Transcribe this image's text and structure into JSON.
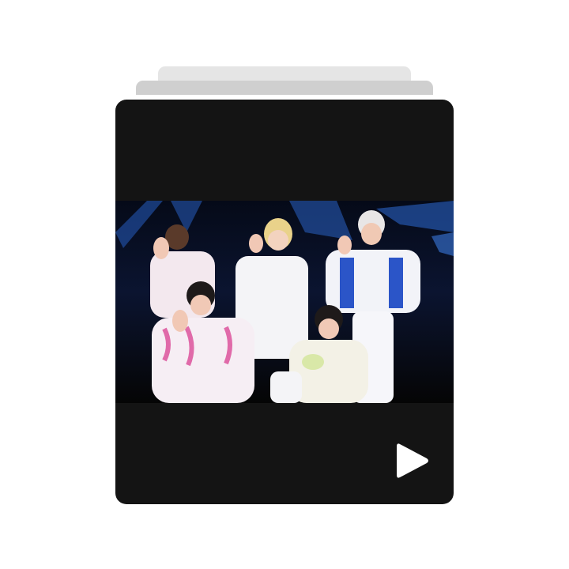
{
  "post": {
    "type": "video-carousel",
    "media_description_icon": "concert-photo",
    "colors": {
      "card_background": "#141414",
      "stack_back": "#e5e5e5",
      "stack_mid": "#cfcfcf",
      "play_icon": "#ffffff"
    },
    "icons": {
      "play": "play-icon"
    }
  }
}
